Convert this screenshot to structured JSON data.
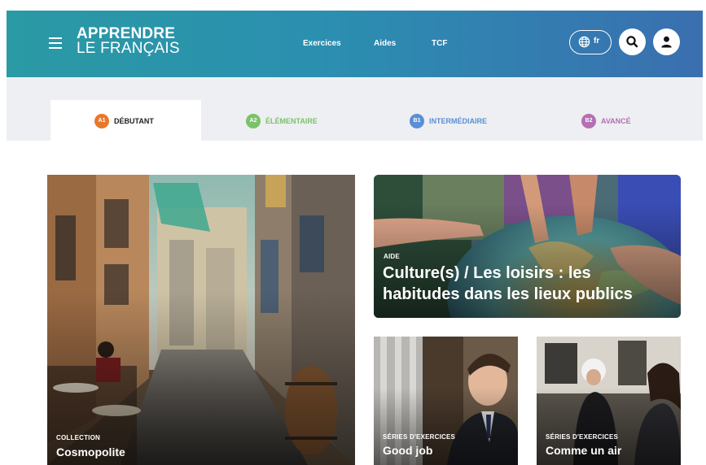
{
  "header": {
    "logo_line1": "APPRENDRE",
    "logo_line2": "LE FRANÇAIS",
    "nav": [
      "Exercices",
      "Aides",
      "TCF"
    ],
    "lang_code": "fr"
  },
  "levels": [
    {
      "badge": "A1",
      "label": "DÉBUTANT",
      "color": "#e8792a",
      "active": true
    },
    {
      "badge": "A2",
      "label": "ÉLÉMENTAIRE",
      "color": "#7bc26b",
      "active": false
    },
    {
      "badge": "B1",
      "label": "INTERMÉDIAIRE",
      "color": "#5a8fd6",
      "active": false
    },
    {
      "badge": "B2",
      "label": "AVANCÉ",
      "color": "#b56fb3",
      "active": false
    }
  ],
  "cards": [
    {
      "category": "COLLECTION",
      "title": "Cosmopolite",
      "image": "narrow-street-cafe"
    },
    {
      "category": "AIDE",
      "title_line1": "Culture(s) / Les loisirs : les",
      "title_line2": "habitudes dans les lieux publics",
      "image": "hands-on-globe"
    },
    {
      "category": "SÉRIES D'EXERCICES",
      "title": "Good job",
      "image": "man-in-suit"
    },
    {
      "category": "SÉRIES D'EXERCICES",
      "title": "Comme un air",
      "image": "people-in-street"
    }
  ],
  "colors": {
    "header_start": "#2a9aa4",
    "header_end": "#3a6fb0",
    "band_bg": "#edeff2"
  }
}
